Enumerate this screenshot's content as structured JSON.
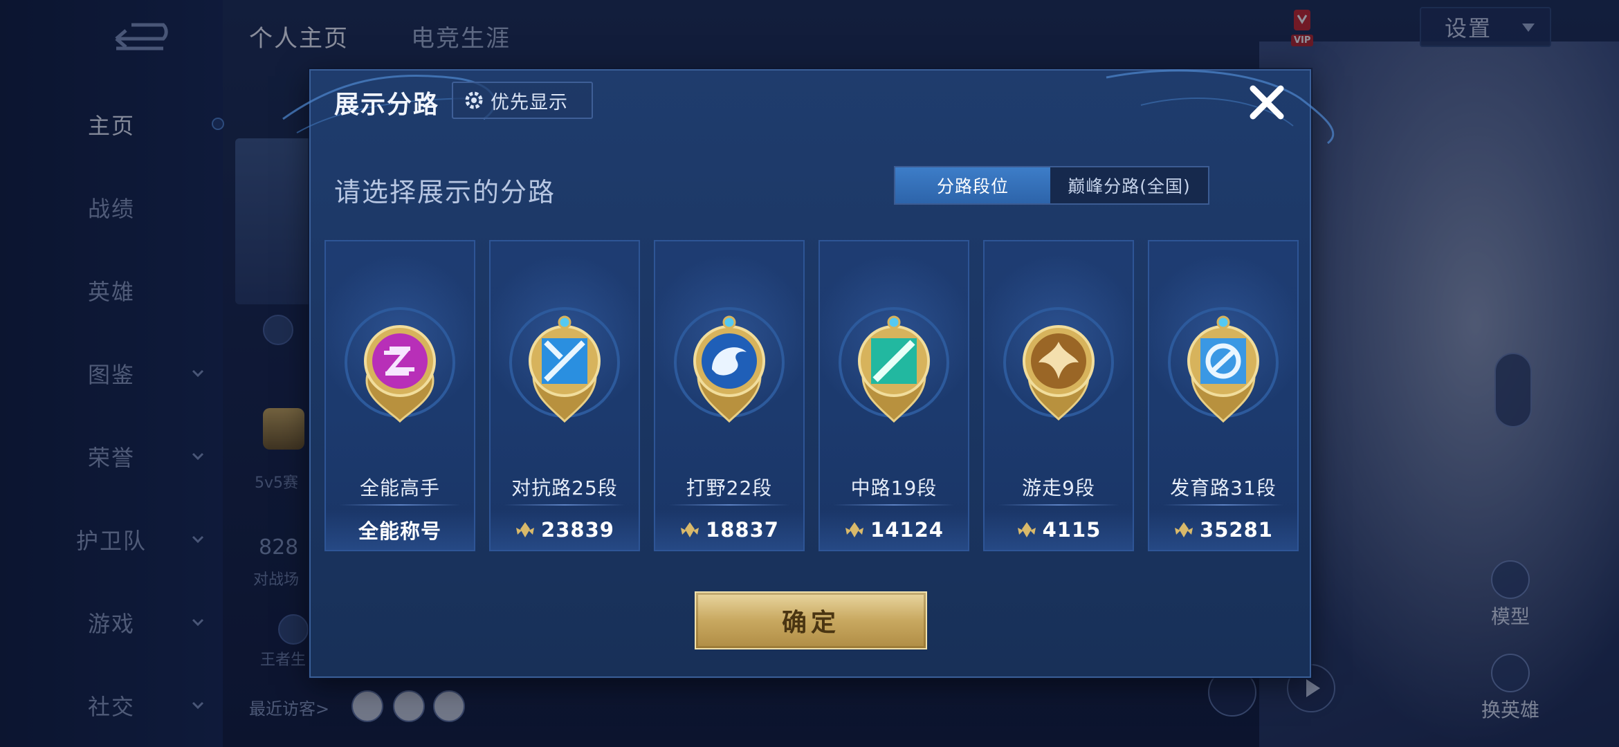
{
  "sidebar": {
    "items": [
      {
        "label": "主页",
        "active": true
      },
      {
        "label": "战绩"
      },
      {
        "label": "英雄"
      },
      {
        "label": "图鉴"
      },
      {
        "label": "荣誉"
      },
      {
        "label": "护卫队"
      },
      {
        "label": "游戏"
      },
      {
        "label": "社交"
      }
    ]
  },
  "header": {
    "tabs": [
      {
        "label": "个人主页",
        "active": true
      },
      {
        "label": "电竞生涯"
      }
    ],
    "settings_label": "设置",
    "vip_label": "VIP"
  },
  "background": {
    "stat_number": "828",
    "stat_label": "对战场",
    "mode_label": "5v5赛",
    "stat_sub": "王者生",
    "visitors_label": "最近访客>",
    "model_label": "模型",
    "change_hero_label": "换英雄"
  },
  "modal": {
    "title": "展示分路",
    "priority_label": "优先显示",
    "prompt": "请选择展示的分路",
    "mode_tabs": [
      {
        "label": "分路段位",
        "active": true
      },
      {
        "label": "巅峰分路(全国)",
        "active": false
      }
    ],
    "cards": [
      {
        "name": "全能高手",
        "value": "全能称号",
        "icon": "all-round-emblem-icon",
        "color": "#c23bc6",
        "has_points": false
      },
      {
        "name": "对抗路25段",
        "value": "23839",
        "icon": "clash-lane-emblem-icon",
        "color": "#2a8fe0",
        "has_points": true
      },
      {
        "name": "打野22段",
        "value": "18837",
        "icon": "jungle-emblem-icon",
        "color": "#1f5fb8",
        "has_points": true
      },
      {
        "name": "中路19段",
        "value": "14124",
        "icon": "mid-lane-emblem-icon",
        "color": "#22b8a0",
        "has_points": true
      },
      {
        "name": "游走9段",
        "value": "4115",
        "icon": "roam-emblem-icon",
        "color": "#b07a2a",
        "has_points": true
      },
      {
        "name": "发育路31段",
        "value": "35281",
        "icon": "farm-lane-emblem-icon",
        "color": "#3a98e4",
        "has_points": true
      }
    ],
    "confirm_label": "确定"
  },
  "colors": {
    "accent_blue": "#3d7dc8",
    "gold": "#c8a860",
    "modal_bg": "#1b3663"
  }
}
